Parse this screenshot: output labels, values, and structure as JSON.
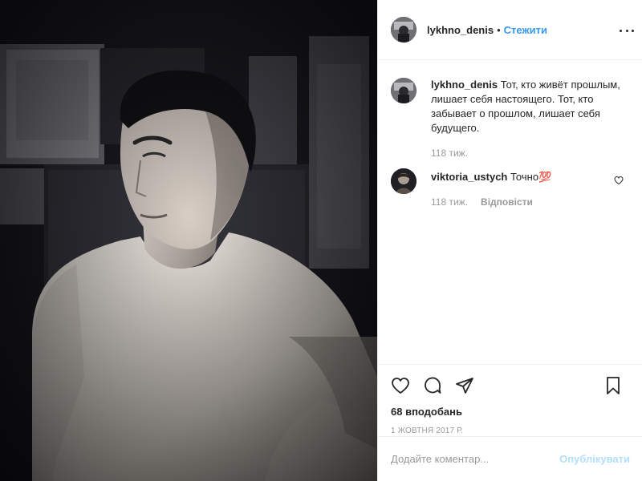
{
  "post": {
    "author": {
      "username": "lykhno_denis",
      "avatar_icon": "avatar-image"
    },
    "follow_label": "Стежити",
    "separator": "•",
    "more_icon": "more-horizontal-icon"
  },
  "caption": {
    "username": "lykhno_denis",
    "text": "Тот, кто живёт прошлым, лишает себя настоящего. Тот, кто забывает о прошлом, лишает себя будущего.",
    "time": "118 тиж."
  },
  "comments": [
    {
      "username": "viktoria_ustych",
      "text": "Точно💯",
      "time": "118 тиж.",
      "reply_label": "Відповісти",
      "like_icon": "heart-outline-icon"
    }
  ],
  "actions": {
    "like_icon": "heart-outline-icon",
    "comment_icon": "comment-bubble-icon",
    "share_icon": "paper-plane-icon",
    "save_icon": "bookmark-icon"
  },
  "likes": "68 вподобань",
  "date": "1 жовтня 2017 р.",
  "add_comment": {
    "placeholder": "Додайте коментар...",
    "publish_label": "Опублікувати"
  },
  "colors": {
    "link_blue": "#3897f0",
    "publish_disabled": "#b2dffc",
    "muted_text": "#999999",
    "text": "#262626",
    "border": "#efefef"
  }
}
